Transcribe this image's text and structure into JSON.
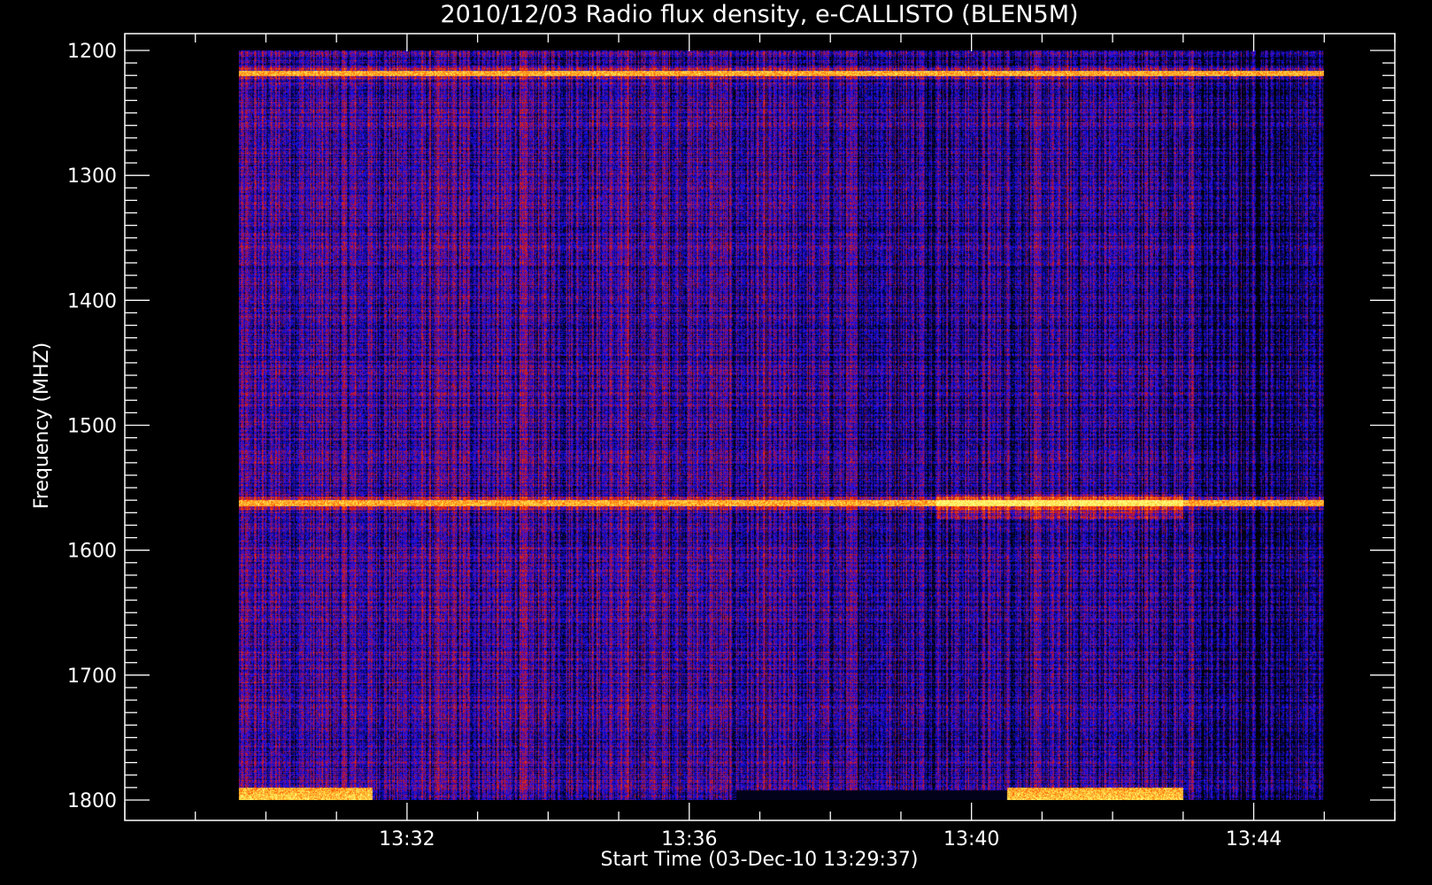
{
  "chart_data": {
    "type": "heatmap",
    "title": "2010/12/03  Radio flux density, e-CALLISTO (BLEN5M)",
    "xlabel": "Start Time (03-Dec-10 13:29:37)",
    "ylabel": "Frequency (MHZ)",
    "x_start": "13:29:37",
    "x_end": "13:45:00",
    "xlim": [
      "13:28",
      "13:46"
    ],
    "ylim": [
      1800,
      1200
    ],
    "y_inverted": true,
    "x_ticks": [
      "13:32",
      "13:36",
      "13:40",
      "13:44"
    ],
    "y_ticks": [
      1200,
      1300,
      1400,
      1500,
      1600,
      1700,
      1800
    ],
    "colormap": [
      "#000000",
      "#1010ff",
      "#c0102a",
      "#ff4a00",
      "#ffc830",
      "#ffff80"
    ],
    "background": "#000000",
    "features": [
      {
        "kind": "constant-frequency band",
        "frequency_mhz": 1218,
        "from": "13:29:37",
        "to": "13:45:00"
      },
      {
        "kind": "constant-frequency band",
        "frequency_mhz": 1562,
        "from": "13:29:37",
        "to": "13:45:00"
      },
      {
        "kind": "enhanced emission",
        "frequency_range_mhz": [
          1555,
          1575
        ],
        "from": "13:39:30",
        "to": "13:43:00"
      },
      {
        "kind": "bright edge",
        "frequency_range_mhz": [
          1790,
          1800
        ],
        "from": "13:29:37",
        "to": "13:31:30"
      },
      {
        "kind": "bright edge",
        "frequency_range_mhz": [
          1790,
          1800
        ],
        "from": "13:40:30",
        "to": "13:43:00"
      }
    ]
  }
}
